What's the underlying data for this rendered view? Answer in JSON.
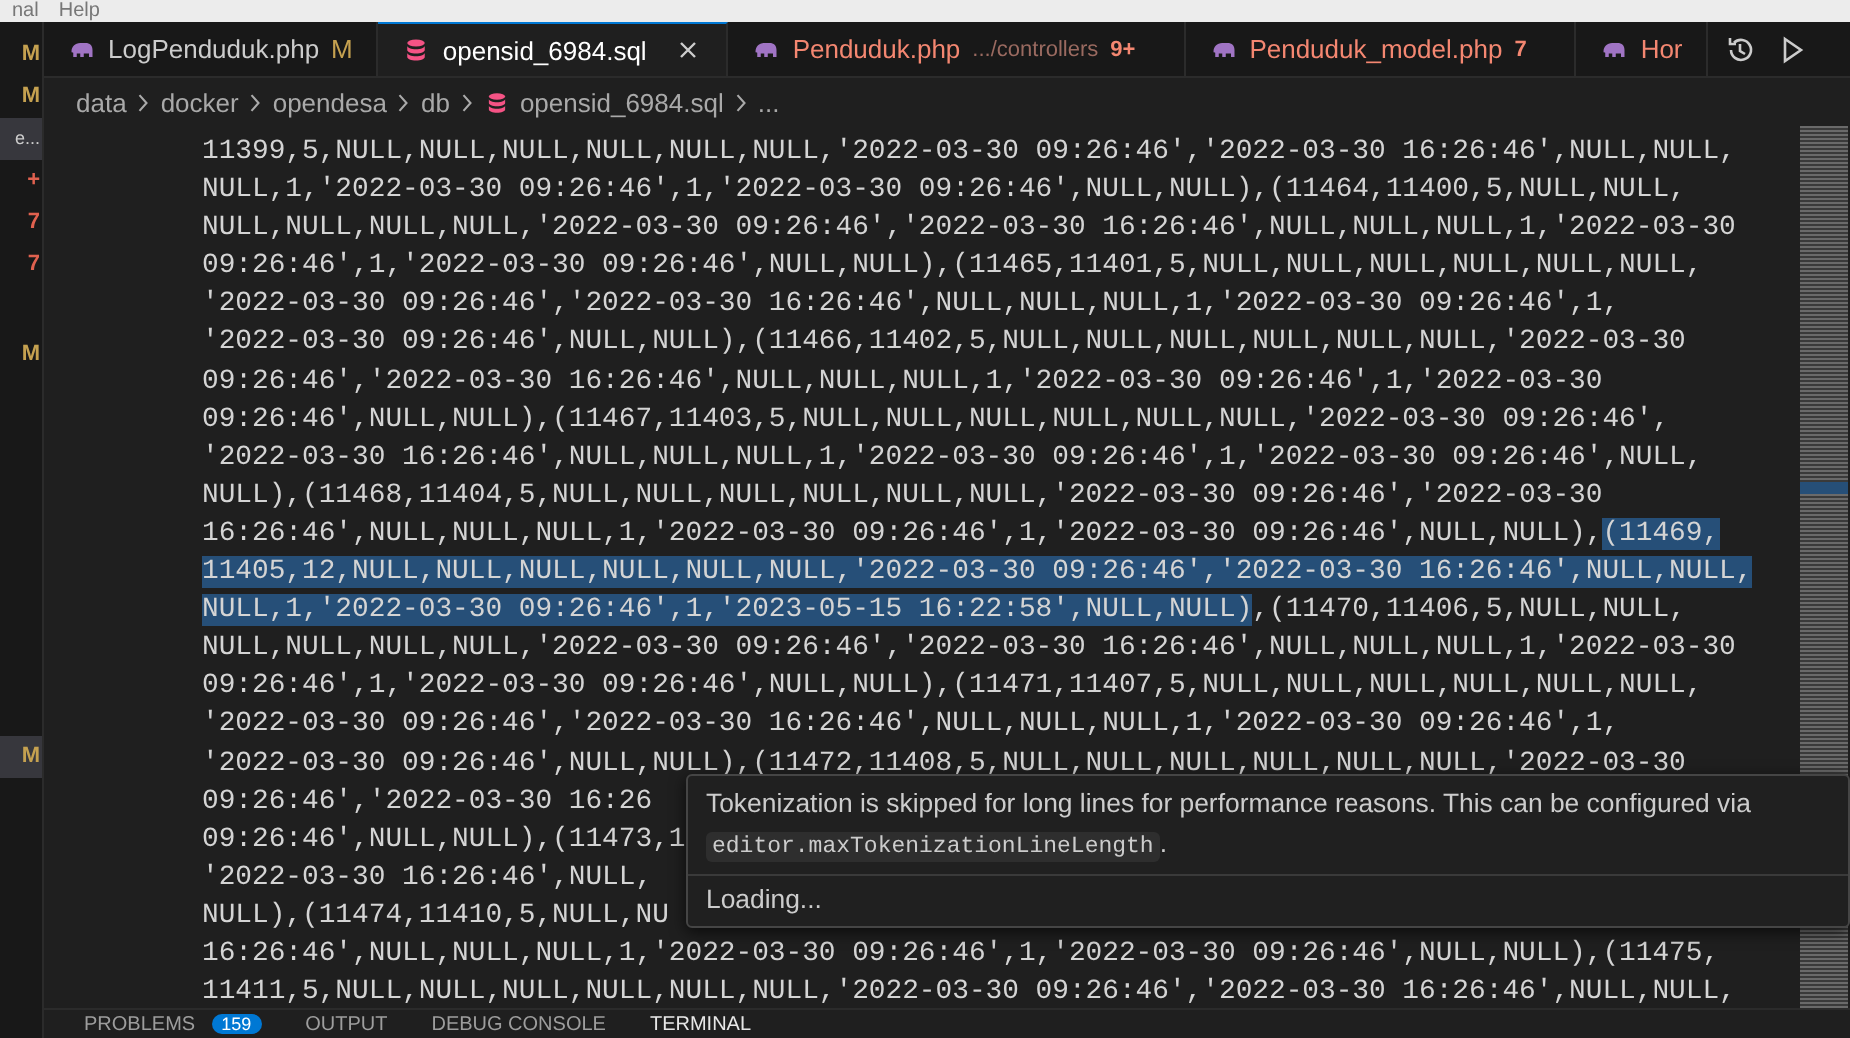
{
  "menu_bar": {
    "items": [
      "nal",
      "Help"
    ]
  },
  "explorer_badges": [
    {
      "text": "M",
      "selected": false
    },
    {
      "text": "M",
      "selected": false
    },
    {
      "text": "e...",
      "selected": true
    },
    {
      "text": "+",
      "selected": false
    },
    {
      "text": "7",
      "selected": false
    },
    {
      "text": "7",
      "selected": false
    },
    {
      "text": "M",
      "selected": false
    },
    {
      "text": "M",
      "selected": true
    }
  ],
  "tabs": [
    {
      "label": "LogPenduduk.php",
      "kind": "php",
      "badge": "M",
      "has_problems": false,
      "selected": false
    },
    {
      "label": "opensid_6984.sql",
      "kind": "sql",
      "has_problems": false,
      "selected": true
    },
    {
      "label": "Penduduk.php",
      "kind": "php",
      "path": ".../controllers",
      "badge": "9+",
      "has_problems": true,
      "selected": false
    },
    {
      "label": "Penduduk_model.php",
      "kind": "php",
      "badge": "7",
      "has_problems": true,
      "selected": false
    },
    {
      "label": "Hor",
      "kind": "php",
      "has_problems": true,
      "selected": false
    }
  ],
  "breadcrumbs": [
    {
      "label": "data",
      "kind": "folder"
    },
    {
      "label": "docker",
      "kind": "folder"
    },
    {
      "label": "opendesa",
      "kind": "folder"
    },
    {
      "label": "db",
      "kind": "folder"
    },
    {
      "label": "opensid_6984.sql",
      "kind": "sql"
    },
    {
      "label": "...",
      "kind": "more"
    }
  ],
  "code_lines": [
    {
      "segments": [
        {
          "text": "11399,5,NULL,NULL,NULL,NULL,NULL,NULL,'2022-03-30 09:26:46','2022-03-30 16:26:46',NULL,NULL,",
          "selected": false
        }
      ]
    },
    {
      "segments": [
        {
          "text": "NULL,1,'2022-03-30 09:26:46',1,'2022-03-30 09:26:46',NULL,NULL),(11464,11400,5,NULL,NULL,",
          "selected": false
        }
      ]
    },
    {
      "segments": [
        {
          "text": "NULL,NULL,NULL,NULL,'2022-03-30 09:26:46','2022-03-30 16:26:46',NULL,NULL,NULL,1,'2022-03-30",
          "selected": false
        }
      ]
    },
    {
      "segments": [
        {
          "text": "09:26:46',1,'2022-03-30 09:26:46',NULL,NULL),(11465,11401,5,NULL,NULL,NULL,NULL,NULL,NULL,",
          "selected": false
        }
      ]
    },
    {
      "segments": [
        {
          "text": "'2022-03-30 09:26:46','2022-03-30 16:26:46',NULL,NULL,NULL,1,'2022-03-30 09:26:46',1,",
          "selected": false
        }
      ]
    },
    {
      "segments": [
        {
          "text": "'2022-03-30 09:26:46',NULL,NULL),(11466,11402,5,NULL,NULL,NULL,NULL,NULL,NULL,'2022-03-30",
          "selected": false
        }
      ]
    },
    {
      "segments": [
        {
          "text": "09:26:46','2022-03-30 16:26:46',NULL,NULL,NULL,1,'2022-03-30 09:26:46',1,'2022-03-30",
          "selected": false
        }
      ]
    },
    {
      "segments": [
        {
          "text": "09:26:46',NULL,NULL),(11467,11403,5,NULL,NULL,NULL,NULL,NULL,NULL,'2022-03-30 09:26:46',",
          "selected": false
        }
      ]
    },
    {
      "segments": [
        {
          "text": "'2022-03-30 16:26:46',NULL,NULL,NULL,1,'2022-03-30 09:26:46',1,'2022-03-30 09:26:46',NULL,",
          "selected": false
        }
      ]
    },
    {
      "segments": [
        {
          "text": "NULL),(11468,11404,5,NULL,NULL,NULL,NULL,NULL,NULL,'2022-03-30 09:26:46','2022-03-30",
          "selected": false
        }
      ]
    },
    {
      "segments": [
        {
          "text": "16:26:46',NULL,NULL,NULL,1,'2022-03-30 09:26:46',1,'2022-03-30 09:26:46',NULL,NULL),",
          "selected": false
        },
        {
          "text": "(11469,",
          "selected": true
        }
      ]
    },
    {
      "segments": [
        {
          "text": "11405,12,NULL,NULL,NULL,NULL,NULL,NULL,'2022-03-30 09:26:46','2022-03-30 16:26:46',NULL,NULL,",
          "selected": true
        }
      ]
    },
    {
      "segments": [
        {
          "text": "NULL,1,'2022-03-30 09:26:46',1,'2023-05-15 16:22:58',NULL,NULL)",
          "selected": true
        },
        {
          "text": ",(11470,11406,5,NULL,NULL,",
          "selected": false
        }
      ]
    },
    {
      "segments": [
        {
          "text": "NULL,NULL,NULL,NULL,'2022-03-30 09:26:46','2022-03-30 16:26:46',NULL,NULL,NULL,1,'2022-03-30",
          "selected": false
        }
      ]
    },
    {
      "segments": [
        {
          "text": "09:26:46',1,'2022-03-30 09:26:46',NULL,NULL),(11471,11407,5,NULL,NULL,NULL,NULL,NULL,NULL,",
          "selected": false
        }
      ]
    },
    {
      "segments": [
        {
          "text": "'2022-03-30 09:26:46','2022-03-30 16:26:46',NULL,NULL,NULL,1,'2022-03-30 09:26:46',1,",
          "selected": false
        }
      ]
    },
    {
      "segments": [
        {
          "text": "'2022-03-30 09:26:46',NULL,NULL),(11472,11408,5,NULL,NULL,NULL,NULL,NULL,NULL,'2022-03-30",
          "selected": false
        }
      ]
    },
    {
      "segments": [
        {
          "text": "09:26:46','2022-03-30 16:26",
          "selected": false
        }
      ]
    },
    {
      "segments": [
        {
          "text": "09:26:46',NULL,NULL),(11473,1",
          "selected": false
        }
      ]
    },
    {
      "segments": [
        {
          "text": "'2022-03-30 16:26:46',NULL,",
          "selected": false
        }
      ]
    },
    {
      "segments": [
        {
          "text": "NULL),(11474,11410,5,NULL,NU",
          "selected": false
        }
      ]
    },
    {
      "segments": [
        {
          "text": "16:26:46',NULL,NULL,NULL,1,'2022-03-30 09:26:46',1,'2022-03-30 09:26:46',NULL,NULL),(11475,",
          "selected": false
        }
      ]
    },
    {
      "segments": [
        {
          "text": "11411,5,NULL,NULL,NULL,NULL,NULL,NULL,'2022-03-30 09:26:46','2022-03-30 16:26:46',NULL,NULL,",
          "selected": false
        }
      ]
    }
  ],
  "hover": {
    "message": "Tokenization is skipped for long lines for performance reasons. This can be configured via",
    "setting": "editor.maxTokenizationLineLength",
    "message_end": ".",
    "status": "Loading..."
  },
  "panel_tabs": [
    {
      "label": "PROBLEMS",
      "badge": "159",
      "selected": false
    },
    {
      "label": "OUTPUT",
      "selected": false
    },
    {
      "label": "DEBUG CONSOLE",
      "selected": false
    },
    {
      "label": "TERMINAL",
      "selected": true
    }
  ]
}
